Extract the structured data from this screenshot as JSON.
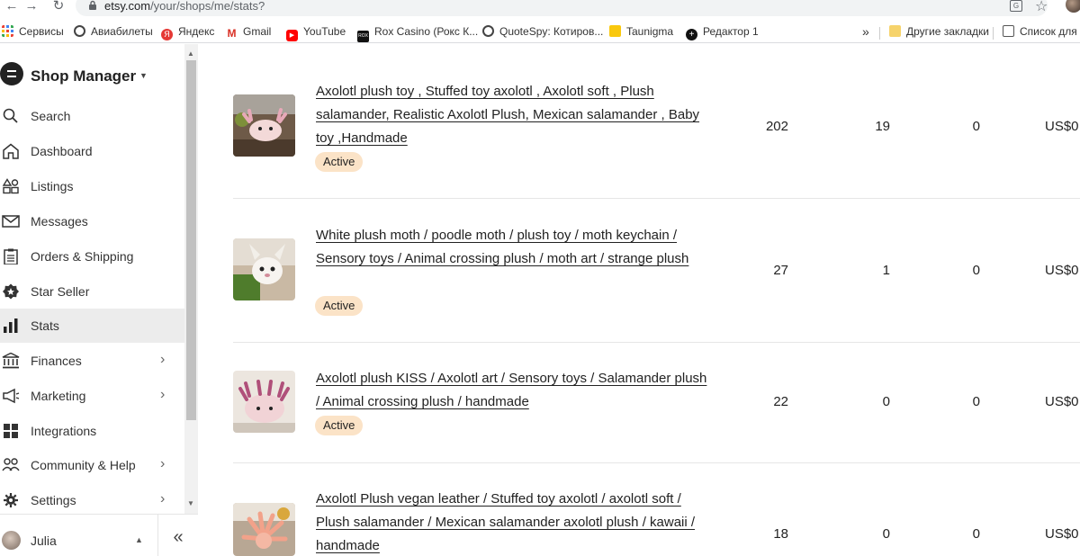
{
  "browser": {
    "url_host": "etsy.com",
    "url_path": "/your/shops/me/stats?",
    "bookmarks": [
      {
        "label": "Сервисы",
        "color": "#4285f4"
      },
      {
        "label": "Авиабилеты",
        "color": "#333333"
      },
      {
        "label": "Яндекс",
        "color": "#e53935"
      },
      {
        "label": "Gmail",
        "color": "#d93025"
      },
      {
        "label": "YouTube",
        "color": "#ff0000"
      },
      {
        "label": "Rox Casino (Рокс К...",
        "color": "#111111"
      },
      {
        "label": "QuoteSpy: Котиров...",
        "color": "#333333"
      },
      {
        "label": "Taunigma",
        "color": "#f9c80e"
      },
      {
        "label": "Редактор 1",
        "color": "#111111"
      }
    ],
    "more_label": "»",
    "other_bookmarks": "Другие закладки",
    "reading_list": "Список для ч"
  },
  "sidebar": {
    "title": "Shop Manager",
    "items": [
      {
        "label": "Search",
        "icon": "search-icon"
      },
      {
        "label": "Dashboard",
        "icon": "home-icon"
      },
      {
        "label": "Listings",
        "icon": "listings-icon"
      },
      {
        "label": "Messages",
        "icon": "envelope-icon"
      },
      {
        "label": "Orders & Shipping",
        "icon": "clipboard-icon"
      },
      {
        "label": "Star Seller",
        "icon": "star-seller-icon"
      },
      {
        "label": "Stats",
        "icon": "bar-chart-icon",
        "active": true
      },
      {
        "label": "Finances",
        "icon": "bank-icon"
      },
      {
        "label": "Marketing",
        "icon": "megaphone-icon"
      },
      {
        "label": "Integrations",
        "icon": "grid-icon"
      },
      {
        "label": "Community & Help",
        "icon": "people-icon"
      },
      {
        "label": "Settings",
        "icon": "gear-icon"
      }
    ],
    "user_name": "Julia",
    "collapse_label": "«"
  },
  "listings": [
    {
      "title": "Axolotl plush toy , Stuffed toy axolotl , Axolotl soft , Plush salamander, Realistic Axolotl Plush, Mexican salamander , Baby toy ,Handmade",
      "status": "Active",
      "views": "202",
      "favorites": "19",
      "orders": "0",
      "revenue": "US$0"
    },
    {
      "title": "White plush moth / poodle moth / plush toy / moth keychain / Sensory toys / Animal crossing plush / moth art / strange plush",
      "status": "Active",
      "views": "27",
      "favorites": "1",
      "orders": "0",
      "revenue": "US$0"
    },
    {
      "title": "Axolotl plush KISS / Axolotl art / Sensory toys / Salamander plush / Animal crossing plush / handmade",
      "status": "Active",
      "views": "22",
      "favorites": "0",
      "orders": "0",
      "revenue": "US$0"
    },
    {
      "title": "Axolotl Plush vegan leather / Stuffed toy axolotl / axolotl soft / Plush salamander / Mexican salamander axolotl plush / kawaii / handmade",
      "views": "18",
      "favorites": "0",
      "orders": "0",
      "revenue": "US$0"
    }
  ]
}
